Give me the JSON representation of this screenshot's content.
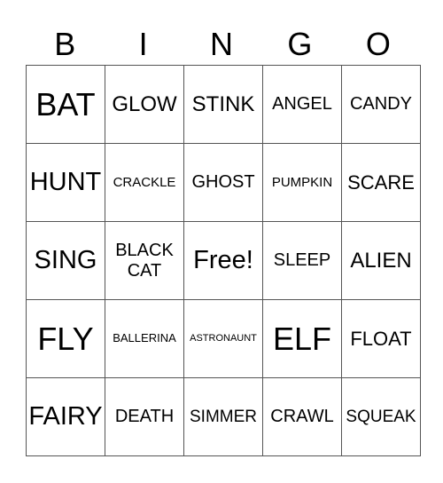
{
  "header": [
    "B",
    "I",
    "N",
    "G",
    "O"
  ],
  "rows": [
    [
      "BAT",
      "GLOW",
      "STINK",
      "ANGEL",
      "CANDY"
    ],
    [
      "HUNT",
      "CRACKLE",
      "GHOST",
      "PUMPKIN",
      "SCARE"
    ],
    [
      "SING",
      "BLACK CAT",
      "Free!",
      "SLEEP",
      "ALIEN"
    ],
    [
      "FLY",
      "BALLERINA",
      "ASTRONAUNT",
      "ELF",
      "FLOAT"
    ],
    [
      "FAIRY",
      "DEATH",
      "SIMMER",
      "CRAWL",
      "SQUEAK"
    ]
  ]
}
